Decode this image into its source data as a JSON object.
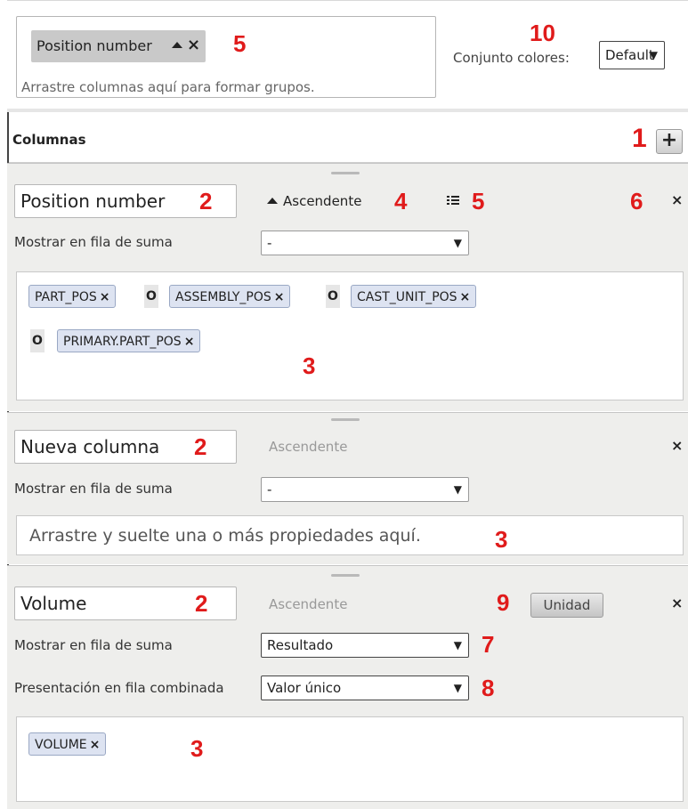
{
  "grouping": {
    "chip_label": "Position number",
    "chip_sort_icon": "triangle-up-icon",
    "chip_close": "✕",
    "hint": "Arrastre columnas aquí para formar grupos."
  },
  "color_set": {
    "label": "Conjunto colores:",
    "value": "Default"
  },
  "columns_header": {
    "title": "Columnas",
    "add_symbol": "+"
  },
  "callouts": {
    "c1": "1",
    "c2a": "2",
    "c2b": "2",
    "c2c": "2",
    "c3a": "3",
    "c3b": "3",
    "c3c": "3",
    "c4": "4",
    "c5a": "5",
    "c5b": "5",
    "c6": "6",
    "c7": "7",
    "c8": "8",
    "c9": "9",
    "c10": "10"
  },
  "column1": {
    "name": "Position number",
    "sort_label": "Ascendente",
    "sum_label": "Mostrar en fila de suma",
    "sum_value": "-",
    "properties": [
      "PART_POS",
      "ASSEMBLY_POS",
      "CAST_UNIT_POS",
      "PRIMARY.PART_POS"
    ],
    "or_label": "O"
  },
  "column2": {
    "name": "Nueva columna",
    "sort_label": "Ascendente",
    "sum_label": "Mostrar en fila de suma",
    "sum_value": "-",
    "drop_hint": "Arrastre y suelte una o más propiedades aquí."
  },
  "column3": {
    "name": "Volume",
    "sort_label": "Ascendente",
    "unit_button": "Unidad",
    "sum_label": "Mostrar en fila de suma",
    "sum_value": "Resultado",
    "combined_label": "Presentación en fila combinada",
    "combined_value": "Valor único",
    "properties": [
      "VOLUME"
    ]
  },
  "close_symbol": "×"
}
